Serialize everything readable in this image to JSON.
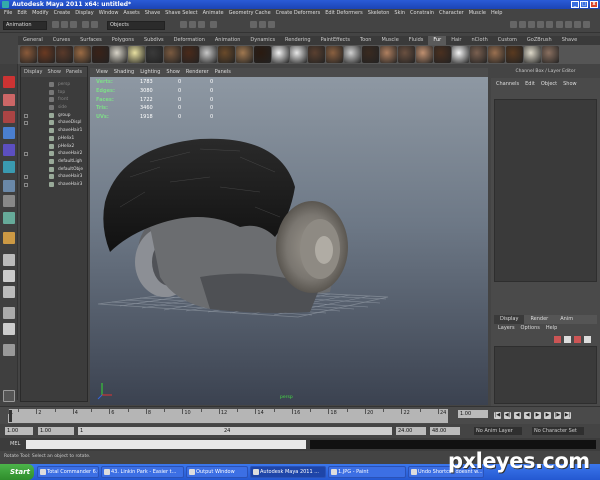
{
  "window": {
    "title": "Autodesk Maya 2011 x64: untitled*"
  },
  "menubar": [
    "File",
    "Edit",
    "Modify",
    "Create",
    "Display",
    "Window",
    "Assets",
    "Shave",
    "Shave Select",
    "Animate",
    "Geometry Cache",
    "Create Deformers",
    "Edit Deformers",
    "Skeleton",
    "Skin",
    "Constrain",
    "Character",
    "Muscle",
    "Help"
  ],
  "statusline": {
    "menuset": "Animation",
    "select_mode": "Objects"
  },
  "shelf": {
    "tabs": [
      "General",
      "Curves",
      "Surfaces",
      "Polygons",
      "Subdivs",
      "Deformation",
      "Animation",
      "Dynamics",
      "Rendering",
      "PaintEffects",
      "Toon",
      "Muscle",
      "Fluids",
      "Fur",
      "Hair",
      "nCloth",
      "Custom",
      "GoZBrush",
      "Shave"
    ],
    "active_tab": "Fur",
    "icon_colors": [
      "#8a5a3a",
      "#6b3a22",
      "#5a3a2a",
      "#9b6b44",
      "#3a2218",
      "#d8d4c8",
      "#e8e0a0",
      "#3a3a3a",
      "#7a5a40",
      "#4a2a1a",
      "#c8c8c8",
      "#6a4a2a",
      "#a07850",
      "#2a1a10",
      "#f0f0f0",
      "#e8e8e8",
      "#5a4030",
      "#8a6040",
      "#d0d0d0",
      "#3a2a20",
      "#b08060",
      "#6a5040",
      "#c09070",
      "#4a3020",
      "#f4f4f4",
      "#7a6050",
      "#9a7050",
      "#5a3a20",
      "#ddd8c8",
      "#8a7060"
    ]
  },
  "outliner": {
    "menu": [
      "Display",
      "Show",
      "Panels"
    ],
    "items": [
      {
        "label": "persp",
        "dim": true,
        "expand": false
      },
      {
        "label": "top",
        "dim": true,
        "expand": false
      },
      {
        "label": "front",
        "dim": true,
        "expand": false
      },
      {
        "label": "side",
        "dim": true,
        "expand": false
      },
      {
        "label": "group",
        "dim": false,
        "expand": true
      },
      {
        "label": "shaveDispl",
        "dim": false,
        "expand": true
      },
      {
        "label": "shaveHair1",
        "dim": false,
        "expand": false
      },
      {
        "label": "pHelix1",
        "dim": false,
        "expand": false
      },
      {
        "label": "pHelix2",
        "dim": false,
        "expand": false
      },
      {
        "label": "shaveHair2",
        "dim": false,
        "expand": true
      },
      {
        "label": "defaultLigh",
        "dim": false,
        "expand": false
      },
      {
        "label": "defaultObje",
        "dim": false,
        "expand": false
      },
      {
        "label": "shaveHair3",
        "dim": false,
        "expand": true
      },
      {
        "label": "shaveHair3",
        "dim": false,
        "expand": true
      }
    ]
  },
  "viewport": {
    "menu": [
      "View",
      "Shading",
      "Lighting",
      "Show",
      "Renderer",
      "Panels"
    ],
    "hud": [
      {
        "label": "Verts:",
        "v1": "1783",
        "v2": "0",
        "v3": "0"
      },
      {
        "label": "Edges:",
        "v1": "3080",
        "v2": "0",
        "v3": "0"
      },
      {
        "label": "Faces:",
        "v1": "1722",
        "v2": "0",
        "v3": "0"
      },
      {
        "label": "Tris:",
        "v1": "3460",
        "v2": "0",
        "v3": "0"
      },
      {
        "label": "UVs:",
        "v1": "1918",
        "v2": "0",
        "v3": "0"
      }
    ],
    "camera_label": "persp"
  },
  "channelbox": {
    "title": "Channel Box / Layer Editor",
    "menu": [
      "Channels",
      "Edit",
      "Object",
      "Show"
    ],
    "layer_tabs": [
      "Display",
      "Render",
      "Anim"
    ],
    "active_layer_tab": "Display",
    "layer_menu": [
      "Layers",
      "Options",
      "Help"
    ]
  },
  "timeslider": {
    "ticks": [
      "1",
      "2",
      "4",
      "6",
      "8",
      "10",
      "12",
      "14",
      "16",
      "18",
      "20",
      "22",
      "24"
    ],
    "current_frame": "1.00",
    "playback_buttons": [
      "|◀",
      "◀|",
      "◀",
      "◀",
      "▶",
      "▶",
      "|▶",
      "▶|"
    ]
  },
  "rangeslider": {
    "start": "1.00",
    "playback_start": "1.00",
    "range_start": "1",
    "range_end": "24",
    "playback_end": "24.00",
    "end": "48.00",
    "anim_layer": "No Anim Layer",
    "character_set": "No Character Set"
  },
  "mel": {
    "label": "MEL"
  },
  "helpline": {
    "text": "Rotate Tool: Select an object to rotate."
  },
  "taskbar": {
    "start_label": "Start",
    "tasks": [
      {
        "label": "Total Commander 6.03 - ...",
        "active": false
      },
      {
        "label": "43. Linkin Park - Easier t...",
        "active": false
      },
      {
        "label": "Output Window",
        "active": false
      },
      {
        "label": "Autodesk Maya 2011 ...",
        "active": true
      },
      {
        "label": "1.JPG - Paint",
        "active": false
      },
      {
        "label": "Undo Shortcut doesnt w...",
        "active": false
      }
    ]
  },
  "watermark": "pxleyes.com"
}
